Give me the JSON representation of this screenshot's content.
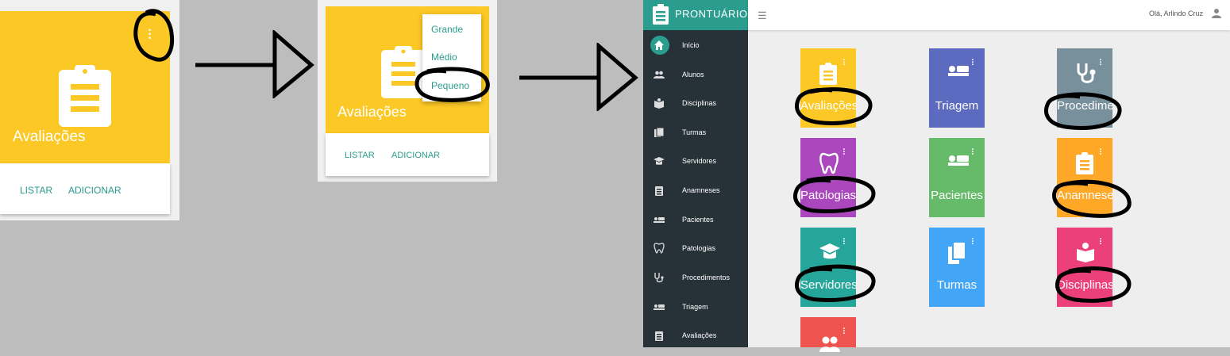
{
  "panel1": {
    "card_title": "Avaliações",
    "actions": [
      "LISTAR",
      "ADICIONAR"
    ],
    "color": "#fcc825"
  },
  "panel2": {
    "card_title": "Avaliações",
    "actions": [
      "LISTAR",
      "ADICIONAR"
    ],
    "menu_options": [
      "Grande",
      "Médio",
      "Pequeno"
    ],
    "selected_option": "Pequeno"
  },
  "app": {
    "brand": "PRONTUÁRIO",
    "greeting": "Olá, Arlindo Cruz",
    "nav": [
      {
        "label": "Início",
        "icon": "home-icon"
      },
      {
        "label": "Alunos",
        "icon": "people-icon"
      },
      {
        "label": "Disciplinas",
        "icon": "book-icon"
      },
      {
        "label": "Turmas",
        "icon": "books-icon"
      },
      {
        "label": "Servidores",
        "icon": "graduation-cap-icon"
      },
      {
        "label": "Anamneses",
        "icon": "clipboard-icon"
      },
      {
        "label": "Pacientes",
        "icon": "bed-icon"
      },
      {
        "label": "Patologias",
        "icon": "tooth-icon"
      },
      {
        "label": "Procedimentos",
        "icon": "stethoscope-icon"
      },
      {
        "label": "Triagem",
        "icon": "bed-icon"
      },
      {
        "label": "Avaliações",
        "icon": "clipboard-icon"
      }
    ],
    "tiles": [
      {
        "label": "Avaliações",
        "color": "#fcc825",
        "icon": "clipboard-icon"
      },
      {
        "label": "Triagem",
        "color": "#5c6bc0",
        "icon": "bed-icon"
      },
      {
        "label": "Procedime",
        "color": "#78909c",
        "icon": "stethoscope-icon"
      },
      {
        "label": "Patologias",
        "color": "#ab47bc",
        "icon": "tooth-icon"
      },
      {
        "label": "Pacientes",
        "color": "#66bb6a",
        "icon": "bed-icon"
      },
      {
        "label": "Anamnese",
        "color": "#ffa726",
        "icon": "clipboard-icon"
      },
      {
        "label": "Servidores",
        "color": "#26a69a",
        "icon": "graduation-cap-icon"
      },
      {
        "label": "Turmas",
        "color": "#42a5f5",
        "icon": "books-icon"
      },
      {
        "label": "Disciplinas",
        "color": "#ec407a",
        "icon": "book-icon"
      },
      {
        "label": "",
        "color": "#ef5350",
        "icon": "people-icon"
      }
    ]
  }
}
